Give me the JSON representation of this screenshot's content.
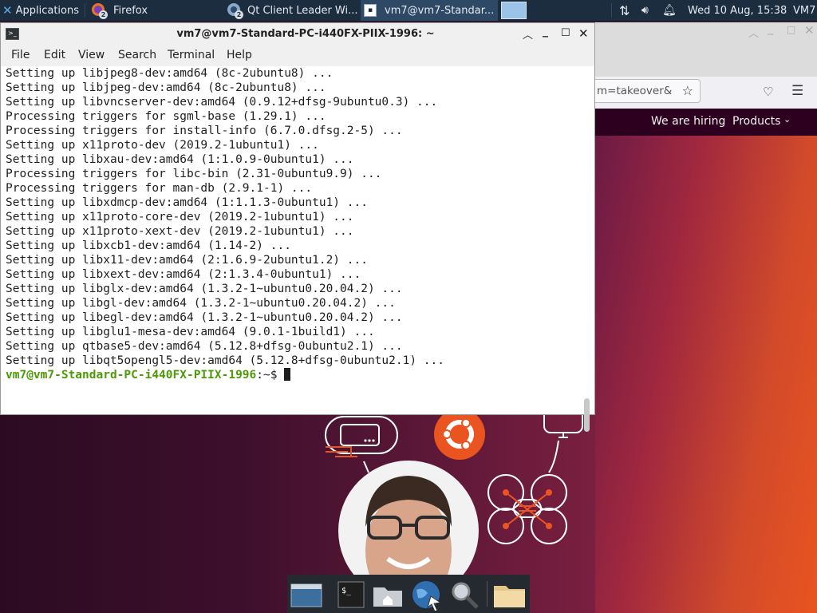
{
  "panel": {
    "applications_label": "Applications",
    "tasks": [
      {
        "label": "Firefox",
        "badge": "2"
      },
      {
        "label": "Qt Client Leader Wi...",
        "badge": "2"
      },
      {
        "label": "vm7@vm7-Standar..."
      }
    ],
    "clock": "Wed 10 Aug, 15:38",
    "user": "VM7"
  },
  "firefox": {
    "url_fragment": "m=takeover&",
    "nav": {
      "hiring": "We are hiring",
      "products": "Products"
    }
  },
  "terminal": {
    "title": "vm7@vm7-Standard-PC-i440FX-PIIX-1996: ~",
    "menu": [
      "File",
      "Edit",
      "View",
      "Search",
      "Terminal",
      "Help"
    ],
    "lines": [
      "Setting up libjpeg8-dev:amd64 (8c-2ubuntu8) ...",
      "Setting up libjpeg-dev:amd64 (8c-2ubuntu8) ...",
      "Setting up libvncserver-dev:amd64 (0.9.12+dfsg-9ubuntu0.3) ...",
      "Processing triggers for sgml-base (1.29.1) ...",
      "Processing triggers for install-info (6.7.0.dfsg.2-5) ...",
      "Setting up x11proto-dev (2019.2-1ubuntu1) ...",
      "Setting up libxau-dev:amd64 (1:1.0.9-0ubuntu1) ...",
      "Processing triggers for libc-bin (2.31-0ubuntu9.9) ...",
      "Processing triggers for man-db (2.9.1-1) ...",
      "Setting up libxdmcp-dev:amd64 (1:1.1.3-0ubuntu1) ...",
      "Setting up x11proto-core-dev (2019.2-1ubuntu1) ...",
      "Setting up x11proto-xext-dev (2019.2-1ubuntu1) ...",
      "Setting up libxcb1-dev:amd64 (1.14-2) ...",
      "Setting up libx11-dev:amd64 (2:1.6.9-2ubuntu1.2) ...",
      "Setting up libxext-dev:amd64 (2:1.3.4-0ubuntu1) ...",
      "Setting up libglx-dev:amd64 (1.3.2-1~ubuntu0.20.04.2) ...",
      "Setting up libgl-dev:amd64 (1.3.2-1~ubuntu0.20.04.2) ...",
      "Setting up libegl-dev:amd64 (1.3.2-1~ubuntu0.20.04.2) ...",
      "Setting up libglu1-mesa-dev:amd64 (9.0.1-1build1) ...",
      "Setting up qtbase5-dev:amd64 (5.12.8+dfsg-0ubuntu2.1) ...",
      "Setting up libqt5opengl5-dev:amd64 (5.12.8+dfsg-0ubuntu2.1) ..."
    ],
    "prompt": "vm7@vm7-Standard-PC-i440FX-PIIX-1996",
    "prompt_suffix": ":~$ "
  },
  "colors": {
    "panel_bg": "#1c2d40",
    "prompt_green": "#4e9a06",
    "ubuntu_orange": "#e95420",
    "ubuntu_aubergine": "#2c001e"
  }
}
